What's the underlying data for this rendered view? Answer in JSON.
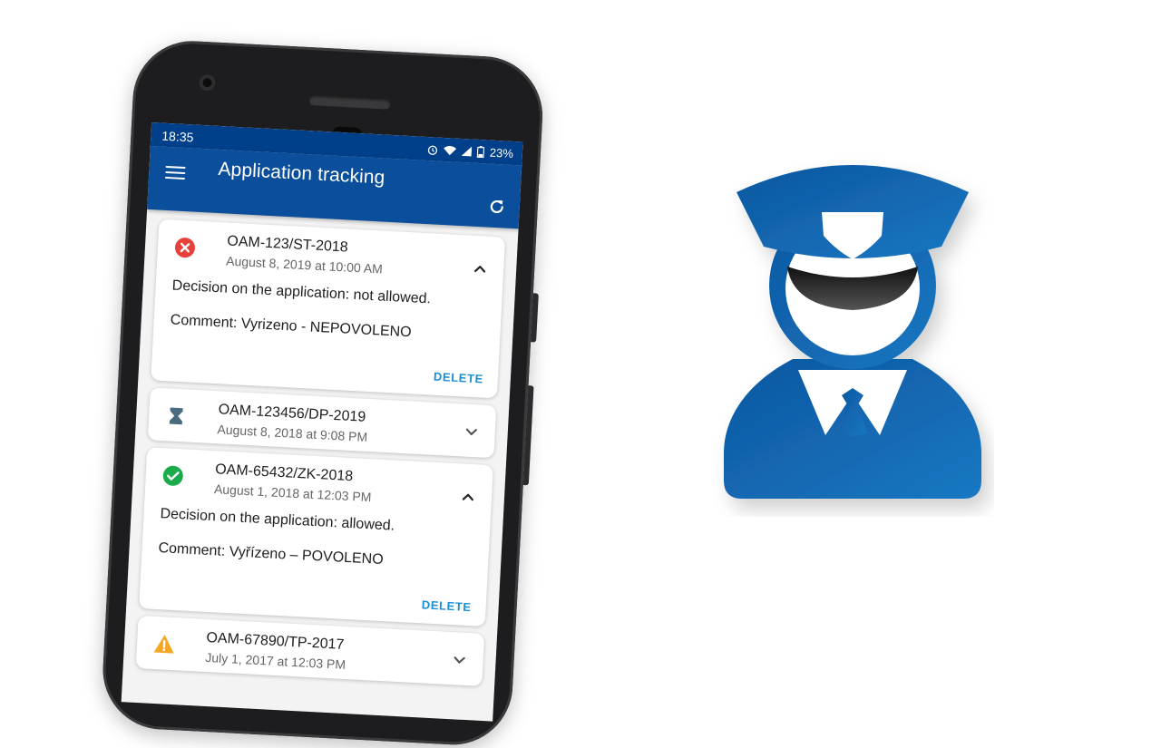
{
  "statusbar": {
    "time": "18:35",
    "battery": "23%"
  },
  "appbar": {
    "title": "Application tracking"
  },
  "applications": [
    {
      "status": "rejected",
      "code": "OAM-123/ST-2018",
      "date": "August 8, 2019 at 10:00 AM",
      "expanded": true,
      "decision": "Decision on the application: not allowed.",
      "comment": "Comment: Vyrizeno - NEPOVOLENO",
      "action": "DELETE"
    },
    {
      "status": "pending",
      "code": "OAM-123456/DP-2019",
      "date": "August 8, 2018 at 9:08 PM",
      "expanded": false
    },
    {
      "status": "approved",
      "code": "OAM-65432/ZK-2018",
      "date": "August 1, 2018 at 12:03 PM",
      "expanded": true,
      "decision": "Decision on the application: allowed.",
      "comment": "Comment: Vyřízeno – POVOLENO",
      "action": "DELETE"
    },
    {
      "status": "warning",
      "code": "OAM-67890/TP-2017",
      "date": "July 1, 2017 at 12:03 PM",
      "expanded": false
    }
  ],
  "icons": {
    "menu": "hamburger-menu-icon",
    "refresh": "refresh-icon",
    "rejected": "error-x-icon",
    "pending": "hourglass-icon",
    "approved": "check-circle-icon",
    "warning": "warning-triangle-icon",
    "expand": "chevron-down-icon",
    "collapse": "chevron-up-icon",
    "logo": "police-officer-icon"
  },
  "colors": {
    "statusbar": "#003f8a",
    "appbar": "#0b4f9c",
    "accent": "#1a8fd9",
    "rejected": "#e8413c",
    "approved": "#1aab4b",
    "warning": "#f5a623",
    "pending": "#4a6a80",
    "logo": "#0f5ba6"
  }
}
